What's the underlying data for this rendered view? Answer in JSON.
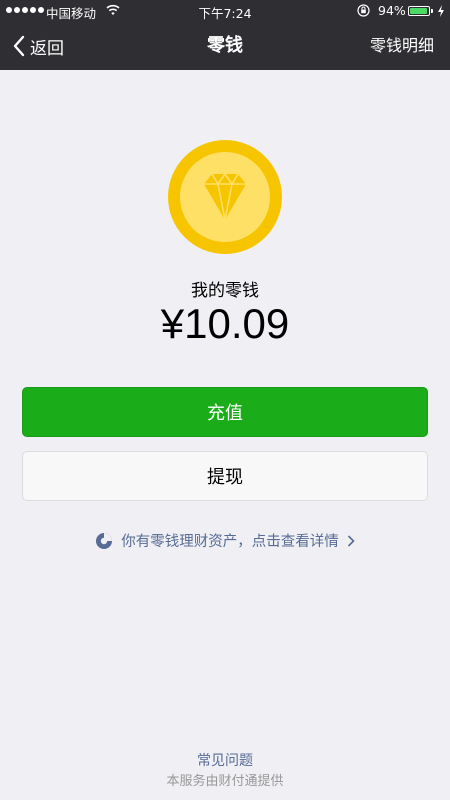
{
  "status_bar": {
    "carrier": "中国移动",
    "time": "下午7:24",
    "battery_percent": "94%",
    "battery_level": 0.94,
    "icons": [
      "signal-dots-icon",
      "wifi-icon",
      "rotation-lock-icon",
      "battery-icon",
      "charging-bolt-icon"
    ]
  },
  "nav": {
    "back_label": "返回",
    "title": "零钱",
    "right_label": "零钱明细"
  },
  "wallet": {
    "label": "我的零钱",
    "amount": "¥10.09",
    "icon": "diamond-coin-icon",
    "coin_color": "#f7c500",
    "coin_inner_color": "#ffe066"
  },
  "buttons": {
    "recharge": "充值",
    "withdraw": "提现"
  },
  "invest_link": {
    "text": "你有零钱理财资产，点击查看详情",
    "icon": "licaitong-icon"
  },
  "footer": {
    "faq": "常见问题",
    "provider": "本服务由财付通提供"
  },
  "colors": {
    "accent_green": "#1aad19",
    "link_blue": "#576b95",
    "nav_background": "#2e2e33",
    "page_background": "#efeff4"
  }
}
